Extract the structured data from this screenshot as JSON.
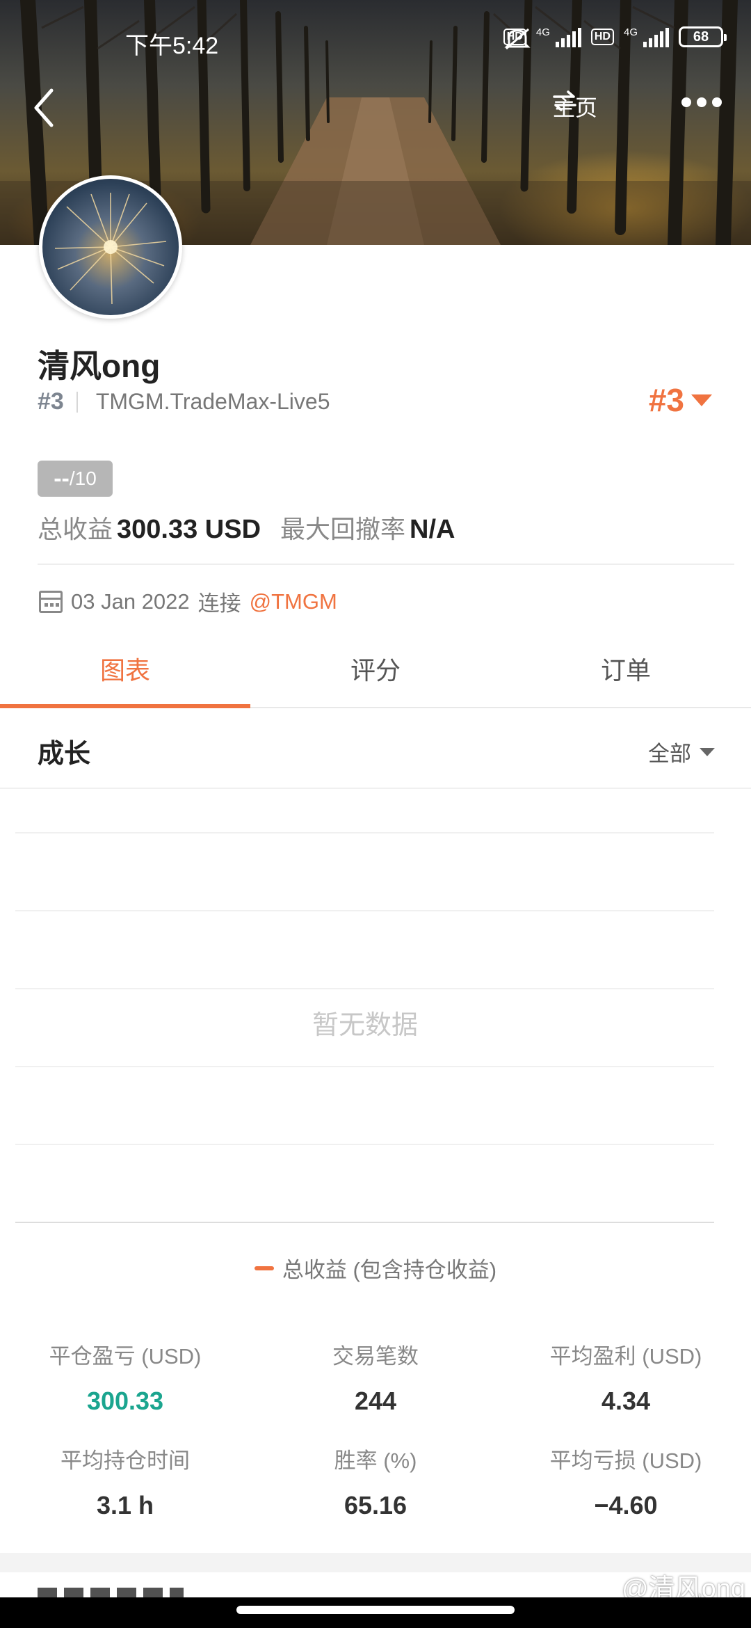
{
  "status_bar": {
    "time": "下午5:42",
    "battery": "68",
    "network": [
      "4G",
      "4G"
    ],
    "hd": [
      "HD",
      "HD"
    ],
    "icons": [
      "alarm-off-icon",
      "signal-icon",
      "battery-icon"
    ]
  },
  "nav": {
    "back_icon": "chevron-left-icon",
    "home_label": "主页",
    "home_icon": "swap-arrows-icon",
    "more_icon": "more-dots-icon"
  },
  "profile": {
    "name": "清风ong",
    "rank_small": "#3",
    "server": "TMGM.TradeMax-Live5",
    "rank_big": "#3",
    "score_main": "--",
    "score_max": "/10",
    "total_profit_label": "总收益",
    "total_profit_value": "300.33 USD",
    "max_drawdown_label": "最大回撤率",
    "max_drawdown_value": "N/A",
    "connect_date": "03 Jan 2022",
    "connect_text": "连接",
    "connect_broker": "@TMGM"
  },
  "tabs": [
    {
      "label": "图表",
      "active": true
    },
    {
      "label": "评分",
      "active": false
    },
    {
      "label": "订单",
      "active": false
    }
  ],
  "growth": {
    "title": "成长",
    "filter": "全部",
    "empty_text": "暂无数据",
    "legend": "总收益 (包含持仓收益)"
  },
  "stats": [
    {
      "label": "平仓盈亏 (USD)",
      "value": "300.33",
      "color": "#1ba58f"
    },
    {
      "label": "交易笔数",
      "value": "244"
    },
    {
      "label": "平均盈利 (USD)",
      "value": "4.34"
    },
    {
      "label": "平均持仓时间",
      "value": "3.1 h"
    },
    {
      "label": "胜率 (%)",
      "value": "65.16"
    },
    {
      "label": "平均亏损 (USD)",
      "value": "−4.60"
    }
  ],
  "watermark": "@清风ong",
  "colors": {
    "accent": "#f07340",
    "profit_green": "#1ba58f",
    "muted": "#888888"
  }
}
